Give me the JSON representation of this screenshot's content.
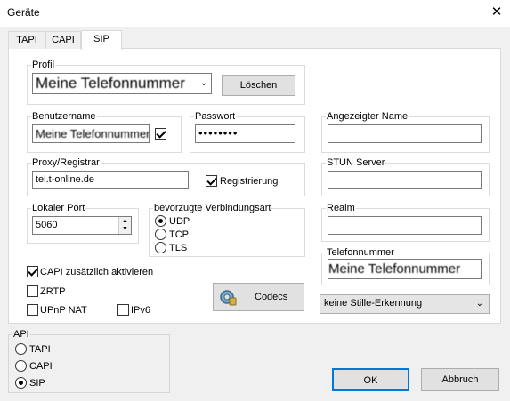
{
  "window": {
    "title": "Geräte"
  },
  "tabs": [
    {
      "label": "TAPI"
    },
    {
      "label": "CAPI"
    },
    {
      "label": "SIP"
    }
  ],
  "profile": {
    "group_label": "Profil",
    "selected_value": "Meine Telefonnummer",
    "delete_button": "Löschen"
  },
  "username": {
    "label": "Benutzername",
    "value": "Meine Telefonnummer",
    "checkbox_checked": true
  },
  "password": {
    "label": "Passwort",
    "value": "••••••••"
  },
  "display_name": {
    "label": "Angezeigter Name",
    "value": ""
  },
  "proxy": {
    "label": "Proxy/Registrar",
    "value": "tel.t-online.de",
    "registration_label": "Registrierung",
    "registration_checked": true
  },
  "stun": {
    "label": "STUN Server",
    "value": ""
  },
  "local_port": {
    "label": "Lokaler Port",
    "value": "5060"
  },
  "connection_type": {
    "label": "bevorzugte Verbindungsart",
    "options": [
      {
        "label": "UDP",
        "checked": true
      },
      {
        "label": "TCP",
        "checked": false
      },
      {
        "label": "TLS",
        "checked": false
      }
    ]
  },
  "realm": {
    "label": "Realm",
    "value": ""
  },
  "phone_number": {
    "label": "Telefonnummer",
    "value": "Meine Telefonnummer"
  },
  "options": {
    "capi_activate": {
      "label": "CAPI zusätzlich aktivieren",
      "checked": true
    },
    "zrtp": {
      "label": "ZRTP",
      "checked": false
    },
    "upnp": {
      "label": "UPnP NAT",
      "checked": false
    },
    "ipv6": {
      "label": "IPv6",
      "checked": false
    }
  },
  "codecs_button": "Codecs",
  "silence_dropdown": {
    "selected_value": "keine Stille-Erkennung"
  },
  "api": {
    "group_label": "API",
    "options": [
      {
        "label": "TAPI",
        "checked": false
      },
      {
        "label": "CAPI",
        "checked": false
      },
      {
        "label": "SIP",
        "checked": true
      }
    ]
  },
  "footer": {
    "ok": "OK",
    "cancel": "Abbruch"
  }
}
